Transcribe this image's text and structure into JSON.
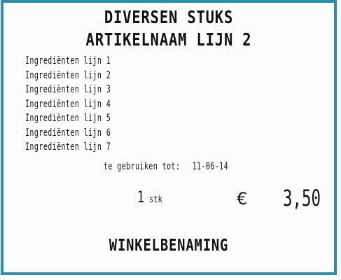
{
  "label": {
    "title_line_1": "DIVERSEN STUKS",
    "title_line_2": "ARTIKELNAAM LIJN 2",
    "ingredients": [
      "Ingrediënten lijn 1",
      "Ingrediënten lijn 2",
      "Ingrediënten lijn 3",
      "Ingrediënten lijn 4",
      "Ingrediënten lijn 5",
      "Ingrediënten lijn 6",
      "Ingrediënten lijn 7"
    ],
    "use_by_label": "te gebruiken tot:",
    "use_by_date": "11-06-14",
    "quantity": "1",
    "quantity_unit": "stk",
    "currency_symbol": "€",
    "price": "3,50",
    "store_name": "WINKELBENAMING"
  },
  "colors": {
    "border": "#2b8fa8",
    "text": "#151515"
  }
}
